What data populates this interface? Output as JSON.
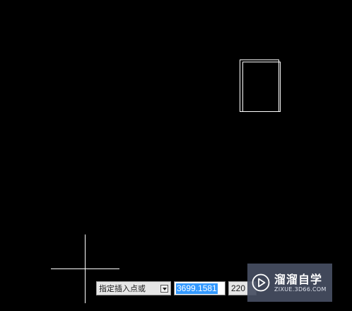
{
  "dynamic_input": {
    "prompt": "指定插入点或",
    "x_value": "3699.1581",
    "y_value": "220"
  },
  "watermark": {
    "brand": "溜溜自学",
    "site": "ZIXUE.3D66.COM",
    "logo_icon": "play-triangle-logo-icon"
  },
  "colors": {
    "canvas": "#000000",
    "geometry": "#ffffff",
    "selection": "#3399ff"
  }
}
